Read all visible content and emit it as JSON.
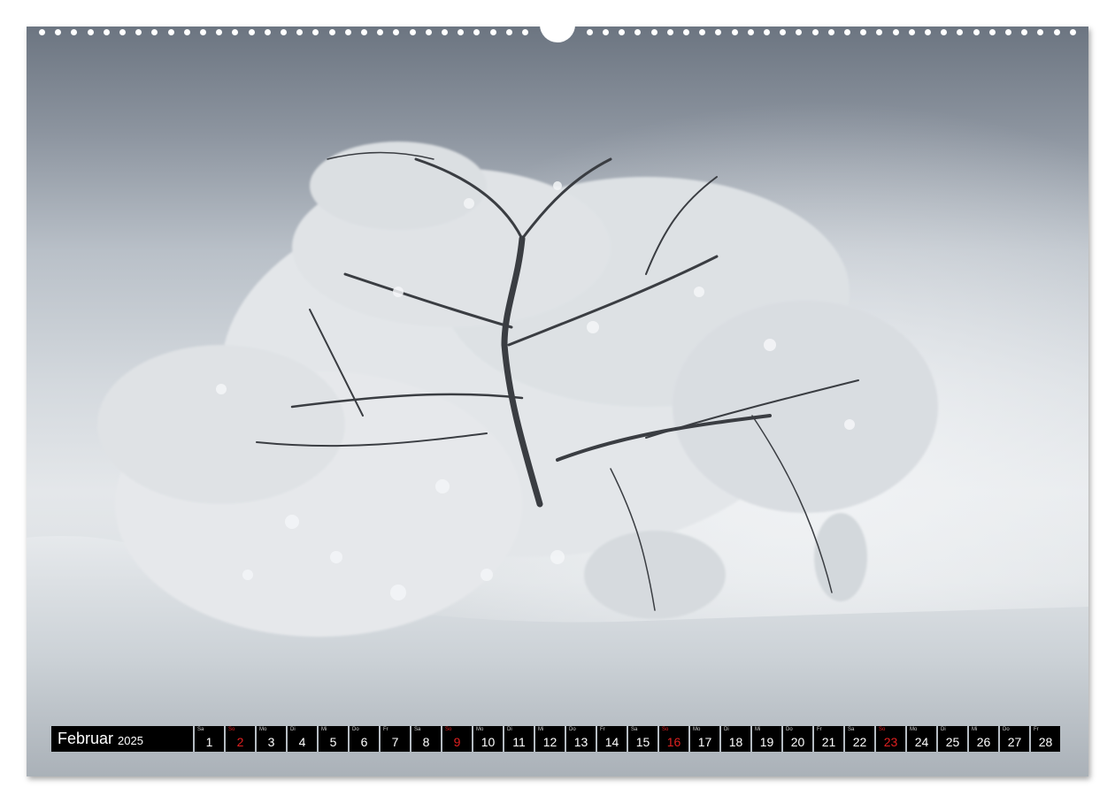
{
  "calendar": {
    "month": "Februar",
    "year": "2025",
    "sunday_color": "#e02020",
    "days": [
      {
        "weekday": "Sa",
        "day": "1",
        "sunday": false
      },
      {
        "weekday": "So",
        "day": "2",
        "sunday": true
      },
      {
        "weekday": "Mo",
        "day": "3",
        "sunday": false
      },
      {
        "weekday": "Di",
        "day": "4",
        "sunday": false
      },
      {
        "weekday": "Mi",
        "day": "5",
        "sunday": false
      },
      {
        "weekday": "Do",
        "day": "6",
        "sunday": false
      },
      {
        "weekday": "Fr",
        "day": "7",
        "sunday": false
      },
      {
        "weekday": "Sa",
        "day": "8",
        "sunday": false
      },
      {
        "weekday": "So",
        "day": "9",
        "sunday": true
      },
      {
        "weekday": "Mo",
        "day": "10",
        "sunday": false
      },
      {
        "weekday": "Di",
        "day": "11",
        "sunday": false
      },
      {
        "weekday": "Mi",
        "day": "12",
        "sunday": false
      },
      {
        "weekday": "Do",
        "day": "13",
        "sunday": false
      },
      {
        "weekday": "Fr",
        "day": "14",
        "sunday": false
      },
      {
        "weekday": "Sa",
        "day": "15",
        "sunday": false
      },
      {
        "weekday": "So",
        "day": "16",
        "sunday": true
      },
      {
        "weekday": "Mo",
        "day": "17",
        "sunday": false
      },
      {
        "weekday": "Di",
        "day": "18",
        "sunday": false
      },
      {
        "weekday": "Mi",
        "day": "19",
        "sunday": false
      },
      {
        "weekday": "Do",
        "day": "20",
        "sunday": false
      },
      {
        "weekday": "Fr",
        "day": "21",
        "sunday": false
      },
      {
        "weekday": "Sa",
        "day": "22",
        "sunday": false
      },
      {
        "weekday": "So",
        "day": "23",
        "sunday": true
      },
      {
        "weekday": "Mo",
        "day": "24",
        "sunday": false
      },
      {
        "weekday": "Di",
        "day": "25",
        "sunday": false
      },
      {
        "weekday": "Mi",
        "day": "26",
        "sunday": false
      },
      {
        "weekday": "Do",
        "day": "27",
        "sunday": false
      },
      {
        "weekday": "Fr",
        "day": "28",
        "sunday": false
      }
    ]
  }
}
